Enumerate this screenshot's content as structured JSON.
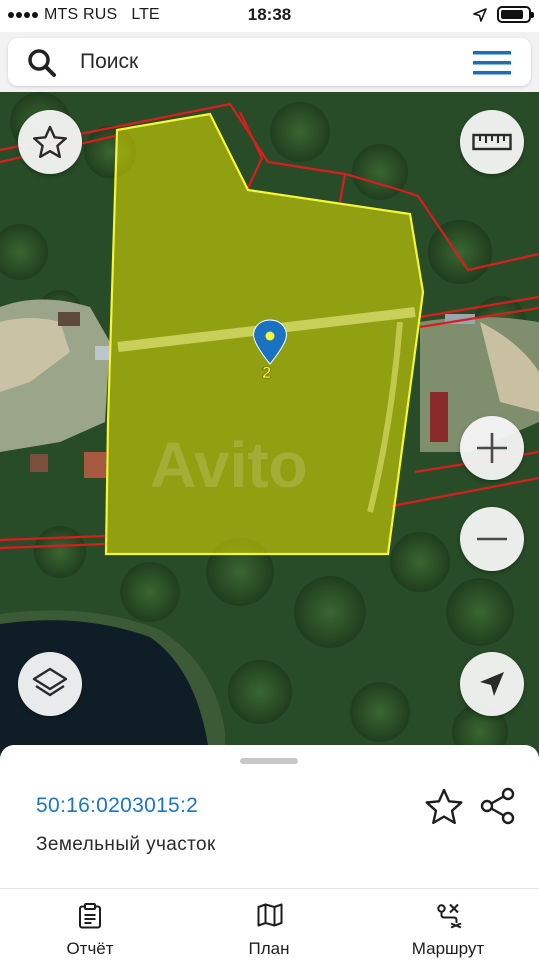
{
  "status_bar": {
    "carrier": "MTS RUS",
    "network": "LTE",
    "time": "18:38"
  },
  "search": {
    "placeholder": "Поиск",
    "icons": {
      "search": "search-icon",
      "menu": "hamburger-menu-icon"
    }
  },
  "map": {
    "mode": "satellite",
    "parcel_marker_label": "2",
    "watermark": "Avito",
    "colors": {
      "parcel_fill": "#e6e600",
      "parcel_border": "#f5f53a",
      "boundary_lines": "#d81e1e",
      "marker": "#1a73c2"
    },
    "controls": {
      "favorite": "star-icon",
      "ruler": "ruler-icon",
      "zoom_in": "plus-icon",
      "zoom_out": "minus-icon",
      "layers": "layers-icon",
      "locate": "location-arrow-icon"
    }
  },
  "sheet": {
    "cadastral_number": "50:16:0203015:2",
    "object_type": "Земельный участок",
    "actions": {
      "favorite": "star-outline-icon",
      "share": "share-icon"
    },
    "accent_color": "#1976c3"
  },
  "tabs": [
    {
      "label": "Отчёт",
      "icon": "report-clipboard-icon"
    },
    {
      "label": "План",
      "icon": "map-plan-icon"
    },
    {
      "label": "Маршрут",
      "icon": "route-icon"
    }
  ]
}
